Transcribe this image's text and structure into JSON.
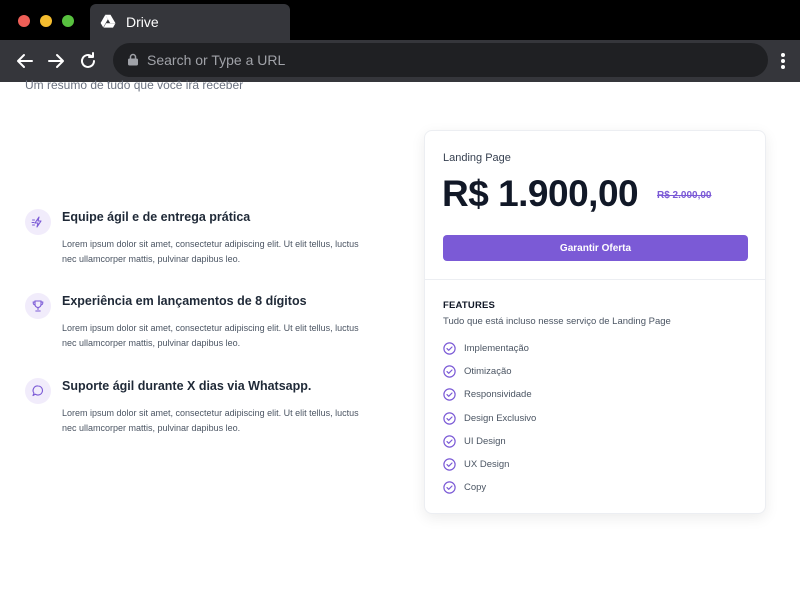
{
  "browser": {
    "tab_title": "Drive",
    "url_placeholder": "Search or Type a URL"
  },
  "page": {
    "subtitle": "Um resumo de tudo que você irá receber",
    "features": [
      {
        "icon": "lightning-icon",
        "title": "Equipe ágil e de entrega prática",
        "description": "Lorem ipsum dolor sit amet, consectetur adipiscing elit. Ut elit tellus, luctus nec ullamcorper mattis, pulvinar dapibus leo."
      },
      {
        "icon": "trophy-icon",
        "title": "Experiência em lançamentos de 8 dígitos",
        "description": "Lorem ipsum dolor sit amet, consectetur adipiscing elit. Ut elit tellus, luctus nec ullamcorper mattis, pulvinar dapibus leo."
      },
      {
        "icon": "chat-icon",
        "title": "Suporte ágil durante X dias via Whatsapp.",
        "description": "Lorem ipsum dolor sit amet, consectetur adipiscing elit. Ut elit tellus, luctus nec ullamcorper mattis, pulvinar dapibus leo."
      }
    ],
    "card": {
      "plan_name": "Landing Page",
      "price": "R$ 1.900,00",
      "old_price": "R$ 2.000,00",
      "cta_label": "Garantir Oferta",
      "features_heading": "FEATURES",
      "features_subtitle": "Tudo que está incluso nesse serviço de Landing Page",
      "items": [
        "Implementação",
        "Otimização",
        "Responsividade",
        "Design Exclusivo",
        "UI Design",
        "UX Design",
        "Copy"
      ]
    }
  },
  "colors": {
    "accent": "#7b5ad6",
    "accent_light": "#f1ecfb",
    "text_dark": "#111827",
    "text_muted": "#4b5563"
  }
}
